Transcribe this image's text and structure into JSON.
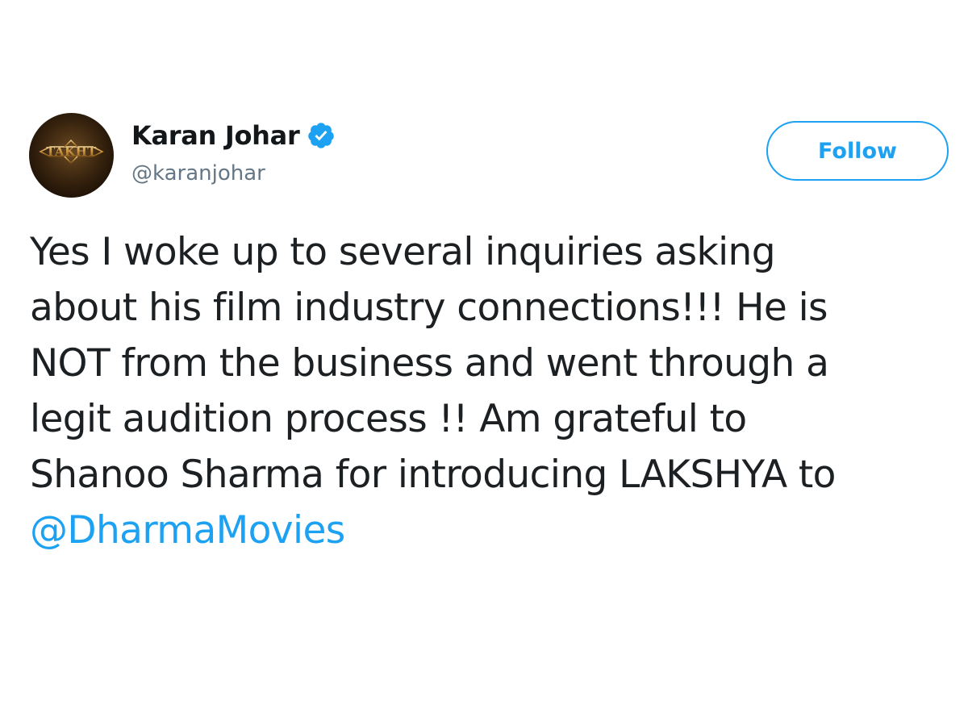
{
  "tweet": {
    "author": {
      "name": "Karan Johar",
      "handle": "@karanjohar",
      "verified": true,
      "avatar_text": "TAKHT"
    },
    "follow_label": "Follow",
    "body_lines": [
      "Yes I woke up to several inquiries asking",
      "about his film industry connections!!! He is",
      "NOT from the business and went through a",
      "legit audition process !! Am grateful to",
      "Shanoo Sharma for introducing LAKSHYA to"
    ],
    "mention": "@DharmaMovies"
  },
  "colors": {
    "accent": "#1da1f2",
    "text": "#1c2022",
    "secondary_text": "#657786"
  },
  "icons": {
    "verified": "verified-badge-icon"
  }
}
